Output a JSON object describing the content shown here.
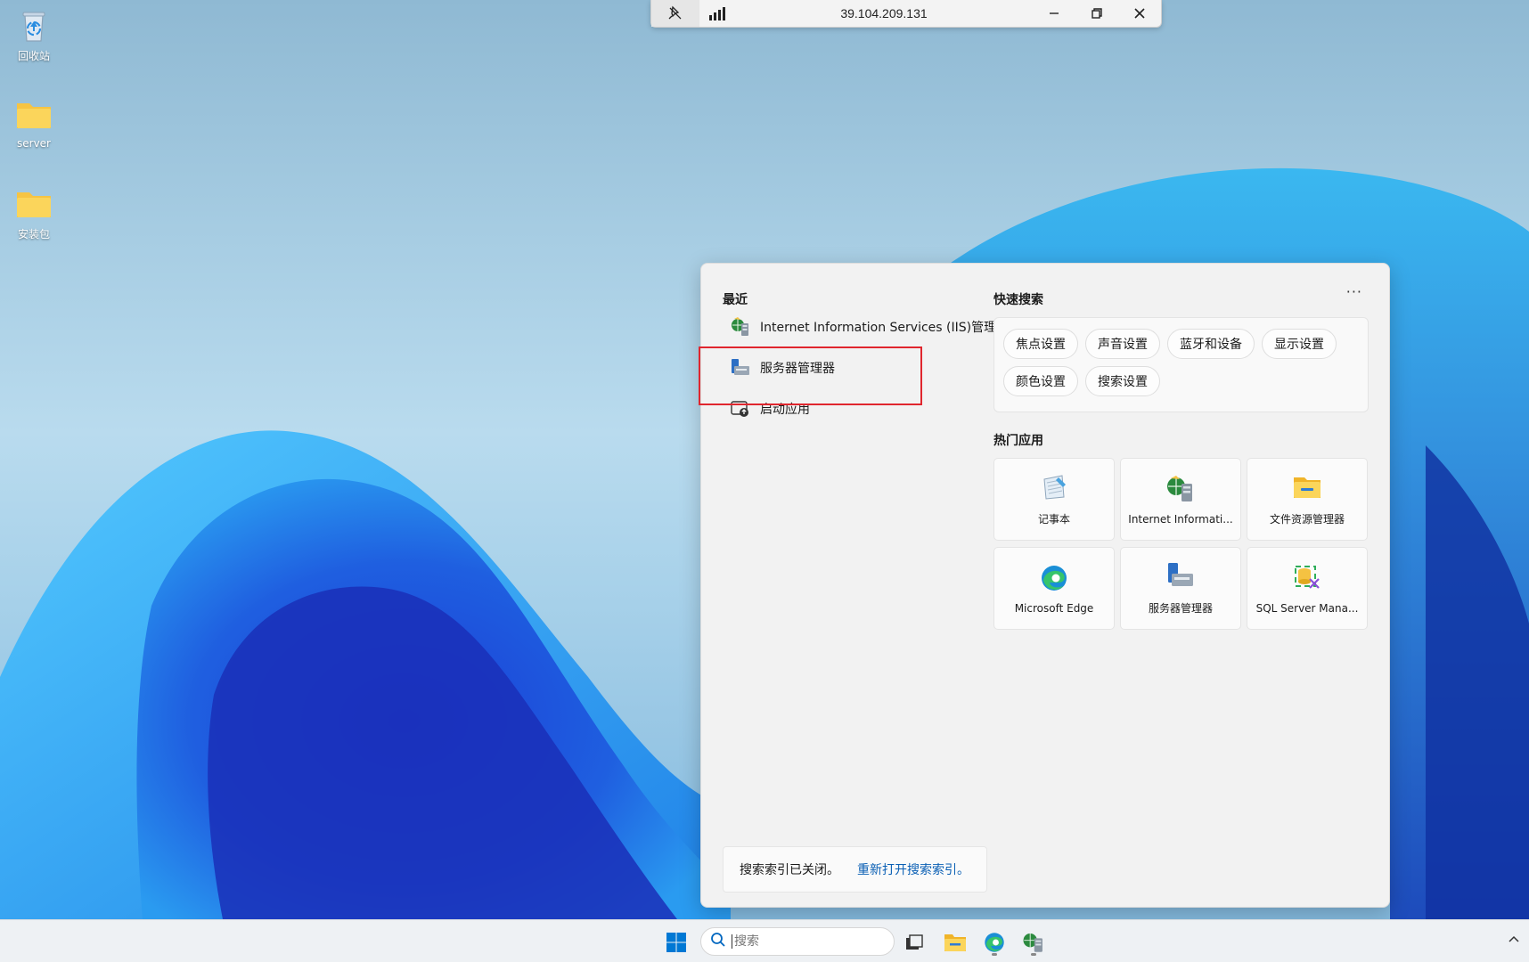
{
  "desktop": {
    "icons": [
      {
        "label": "回收站",
        "icon": "recycle-bin-icon"
      },
      {
        "label": "server",
        "icon": "folder-icon"
      },
      {
        "label": "安装包",
        "icon": "folder-icon"
      }
    ]
  },
  "remote_bar": {
    "ip": "39.104.209.131",
    "icons": [
      "pin-off-icon",
      "signal-icon",
      "minimize-icon",
      "restore-icon",
      "close-icon"
    ]
  },
  "flyout": {
    "recent": {
      "title": "最近",
      "items": [
        {
          "label": "Internet Information Services (IIS)管理器",
          "icon": "iis-icon"
        },
        {
          "label": "服务器管理器",
          "icon": "server-manager-icon"
        },
        {
          "label": "启动应用",
          "icon": "startup-apps-icon"
        }
      ]
    },
    "quick_search": {
      "title": "快速搜索",
      "more": "···",
      "chips": [
        "焦点设置",
        "声音设置",
        "蓝牙和设备",
        "显示设置",
        "颜色设置",
        "搜索设置"
      ]
    },
    "top_apps": {
      "title": "热门应用",
      "apps": [
        {
          "label": "记事本",
          "icon": "notepad-icon"
        },
        {
          "label": "Internet Informati...",
          "icon": "iis-icon"
        },
        {
          "label": "文件资源管理器",
          "icon": "file-explorer-icon"
        },
        {
          "label": "Microsoft Edge",
          "icon": "edge-icon"
        },
        {
          "label": "服务器管理器",
          "icon": "server-manager-icon"
        },
        {
          "label": "SQL Server Mana...",
          "icon": "sql-server-icon"
        }
      ]
    },
    "index_note": {
      "message": "搜索索引已关闭。",
      "link": "重新打开搜索索引。"
    }
  },
  "taskbar": {
    "search_placeholder": "搜索",
    "icons": [
      "windows-start-icon",
      "search-icon",
      "task-view-icon",
      "file-explorer-icon",
      "edge-icon",
      "iis-icon",
      "chevron-up-icon"
    ]
  },
  "colors": {
    "highlight_border": "#e0262e",
    "link": "#0a5fb4",
    "windows_blue": "#0078d4"
  }
}
